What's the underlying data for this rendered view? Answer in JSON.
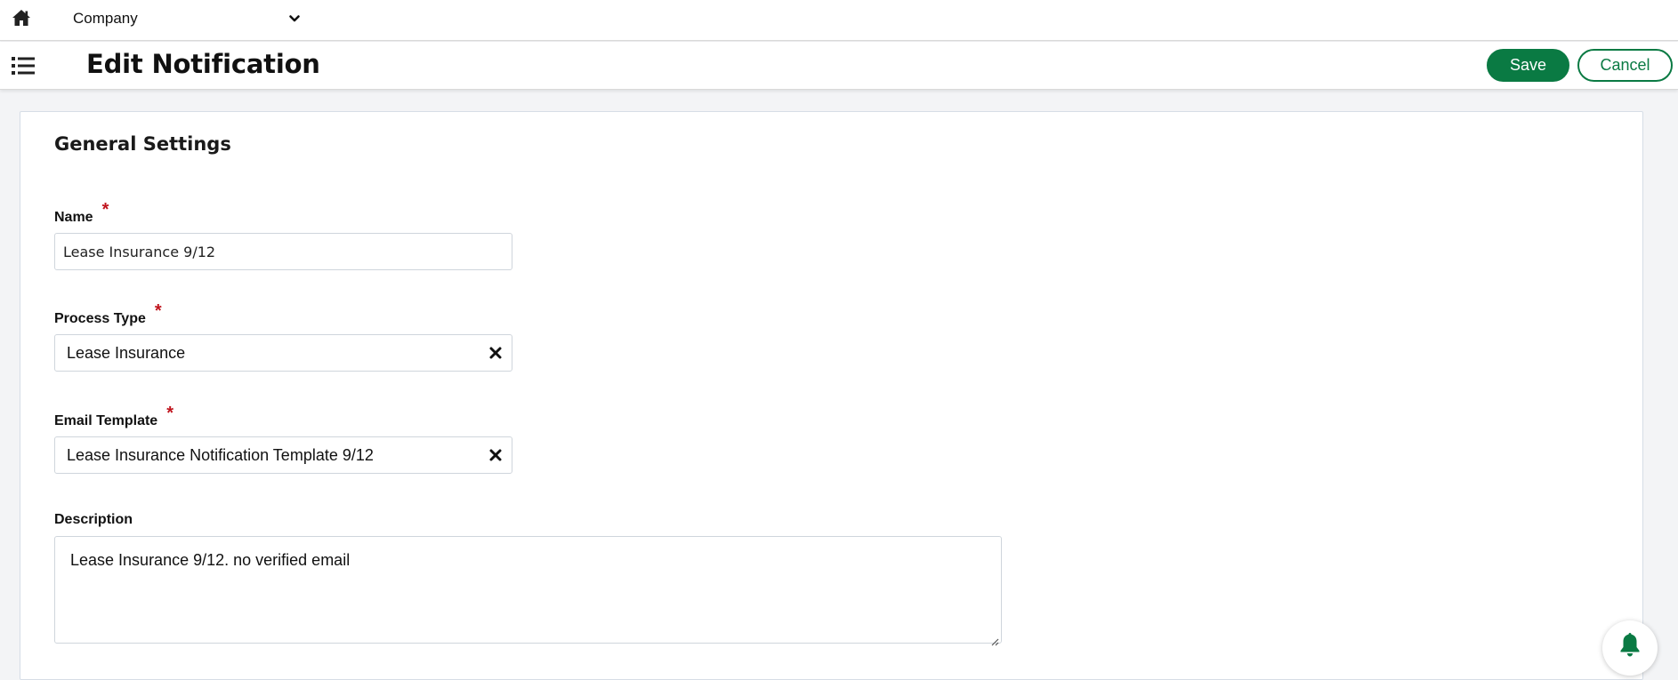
{
  "topbar": {
    "home_icon": "home-icon",
    "company_select": {
      "value": "Company",
      "icon": "chevron-down-icon"
    }
  },
  "header": {
    "menu_icon": "list-icon",
    "title": "Edit Notification",
    "save_label": "Save",
    "cancel_label": "Cancel"
  },
  "form": {
    "section_title": "General Settings",
    "required_marker": "*",
    "name": {
      "label": "Name",
      "value": "Lease Insurance 9/12"
    },
    "process_type": {
      "label": "Process Type",
      "value": "Lease Insurance",
      "clear_icon": "close-icon"
    },
    "email_template": {
      "label": "Email Template",
      "value": "Lease Insurance Notification Template 9/12",
      "clear_icon": "close-icon"
    },
    "description": {
      "label": "Description",
      "value": "Lease Insurance 9/12. no verified email"
    }
  },
  "notifications": {
    "icon": "bell-icon"
  },
  "colors": {
    "accent": "#0a7a43",
    "required": "#c0141d",
    "border": "#cfd5dc",
    "background": "#f3f4f6"
  }
}
